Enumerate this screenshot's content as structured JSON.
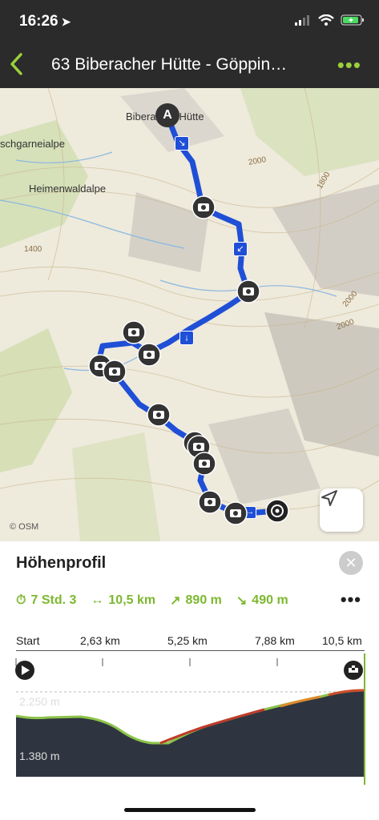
{
  "status": {
    "time": "16:26"
  },
  "nav": {
    "back_icon": "chevron-left-icon",
    "title": "63 Biberacher Hütte - Göppin…",
    "more_icon": "more-icon"
  },
  "map": {
    "labels": {
      "hut": "Biberacher Hütte",
      "alpe1": "schgarneialpe",
      "alpe2": "Heimenwaldalpe",
      "c2000a": "2000",
      "c1800": "1800",
      "c1400": "1400",
      "c2000b": "2000",
      "c2000c": "2000"
    },
    "start_marker": "A",
    "attribution": "© OSM",
    "locate_icon": "navigation-arrow-icon"
  },
  "panel": {
    "title": "Höhenprofil",
    "close_icon": "close-icon",
    "stats": {
      "duration": "7 Std. 3",
      "distance": "10,5 km",
      "ascent": "890 m",
      "descent": "490 m"
    },
    "more_icon": "more-icon",
    "axis": [
      "Start",
      "2,63 km",
      "5,25 km",
      "7,88 km",
      "10,5 km"
    ],
    "elev_top": "2.250 m",
    "elev_bottom": "1.380 m"
  },
  "colors": {
    "accent": "#7cb82f",
    "route": "#1f4fd6",
    "bar": "#2b2b2b",
    "profile_fill": "#2e3540"
  }
}
